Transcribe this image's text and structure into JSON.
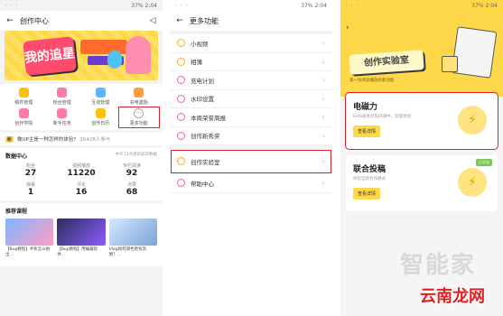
{
  "status": {
    "signal": "37%",
    "time1": "2:04",
    "time2": "2:04",
    "time3": "2:04"
  },
  "panel1": {
    "title": "创作中心",
    "banner": {
      "headline": "我的追星记"
    },
    "grid": [
      {
        "label": "稿件管理"
      },
      {
        "label": "粉丝管理"
      },
      {
        "label": "互动管理"
      },
      {
        "label": "充电激励"
      },
      {
        "label": "创作学院"
      },
      {
        "label": "新手任务"
      },
      {
        "label": "创作日历"
      },
      {
        "label": "更多功能"
      }
    ],
    "hint": {
      "badge": "新",
      "text": "做UP主是一种怎样的体验?",
      "count": "26428人参与"
    },
    "stats": {
      "title": "数据中心",
      "date": "中午12点更新前日数据",
      "cells": [
        {
          "label": "粉丝",
          "value": "27"
        },
        {
          "label": "视频播放",
          "value": "11220"
        },
        {
          "label": "专栏阅读",
          "value": "92"
        },
        {
          "label": "弹幕",
          "value": "1"
        },
        {
          "label": "评论",
          "value": "16"
        },
        {
          "label": "点赞",
          "value": "68"
        }
      ]
    },
    "courses": {
      "title": "推荐课程",
      "items": [
        {
          "title": "【Bup教程】手机怎么拍出..."
        },
        {
          "title": "【Bup教程】用编辑软件..."
        },
        {
          "title": "Vlog如何调色更有氛围？..."
        }
      ]
    }
  },
  "panel2": {
    "title": "更多功能",
    "items": [
      {
        "label": "小视频"
      },
      {
        "label": "相簿"
      },
      {
        "label": "充电计划"
      },
      {
        "label": "水印设置"
      },
      {
        "label": "本周荣誉周报"
      },
      {
        "label": "创作新秀奖"
      },
      {
        "label": "创作实验室"
      },
      {
        "label": "帮助中心"
      }
    ]
  },
  "panel3": {
    "logo": "创作实验室",
    "subtitle": "第一份阅读播放的新功能",
    "cards": [
      {
        "title": "电磁力",
        "desc": "beta版本优先内测中，欢迎体验",
        "button": "查看详情"
      },
      {
        "title": "联合投稿",
        "desc": "体验全新合作模式",
        "button": "查看详情",
        "tag": "已开启"
      }
    ],
    "watermark": "智能家",
    "site": "云南龙网"
  }
}
